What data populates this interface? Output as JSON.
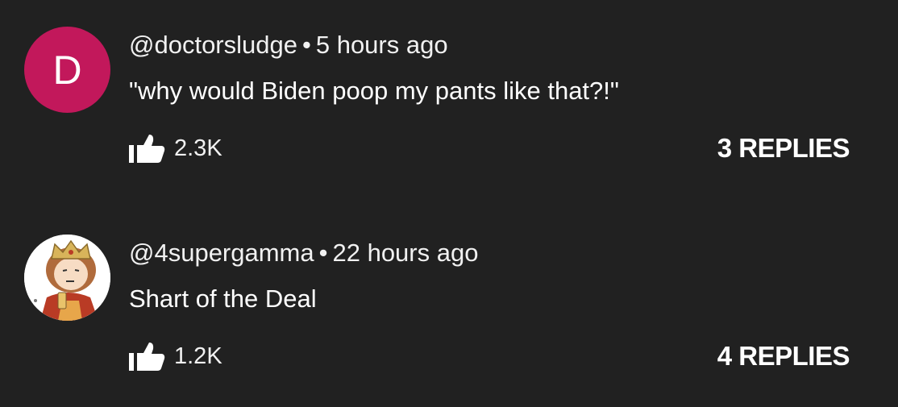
{
  "comments": [
    {
      "avatar_letter": "D",
      "avatar_color": "#c2185b",
      "author": "@doctorsludge",
      "separator": "•",
      "time": "5 hours ago",
      "text": "\"why would Biden poop my pants like that?!\"",
      "like_icon": "thumbs-up-icon",
      "likes": "2.3K",
      "replies": "3 REPLIES"
    },
    {
      "avatar_icon": "cartoon-king-avatar",
      "author": "@4supergamma",
      "separator": "•",
      "time": "22 hours ago",
      "text": "Shart of the Deal",
      "like_icon": "thumbs-up-icon",
      "likes": "1.2K",
      "replies": "4 REPLIES"
    }
  ],
  "colors": {
    "background": "#212121",
    "text": "#f1f1f1"
  }
}
